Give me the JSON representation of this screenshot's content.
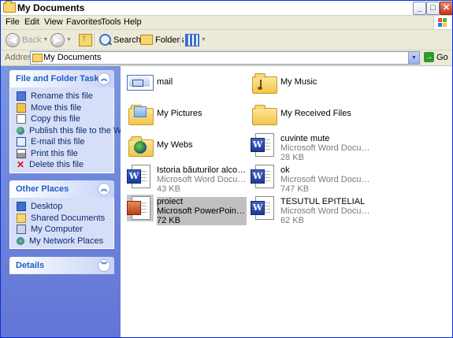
{
  "window": {
    "title": "My Documents",
    "controls": {
      "minimize": "_",
      "maximize": "□",
      "close": "✕"
    }
  },
  "menu": [
    "File",
    "Edit",
    "View",
    "Favorites",
    "Tools",
    "Help"
  ],
  "toolbar": {
    "back": "Back",
    "search": "Search",
    "folders": "Folders"
  },
  "address": {
    "label": "Address",
    "value": "My Documents",
    "go": "Go"
  },
  "tasks": {
    "file_folder": {
      "title": "File and Folder Tasks",
      "items": [
        {
          "label": "Rename this file",
          "icon": "rename-icon"
        },
        {
          "label": "Move this file",
          "icon": "move-icon"
        },
        {
          "label": "Copy this file",
          "icon": "copy-icon"
        },
        {
          "label": "Publish this file to the Web",
          "icon": "globe-icon"
        },
        {
          "label": "E-mail this file",
          "icon": "email-icon"
        },
        {
          "label": "Print this file",
          "icon": "printer-icon"
        },
        {
          "label": "Delete this file",
          "icon": "delete-icon"
        }
      ]
    },
    "other_places": {
      "title": "Other Places",
      "items": [
        {
          "label": "Desktop",
          "icon": "desktop-icon"
        },
        {
          "label": "Shared Documents",
          "icon": "folder-icon"
        },
        {
          "label": "My Computer",
          "icon": "computer-icon"
        },
        {
          "label": "My Network Places",
          "icon": "network-icon"
        }
      ]
    },
    "details": {
      "title": "Details"
    }
  },
  "files": [
    {
      "name": "mail",
      "kind": "mail"
    },
    {
      "name": "My Music",
      "kind": "folder-music"
    },
    {
      "name": "My Pictures",
      "kind": "folder-pictures"
    },
    {
      "name": "My Received Files",
      "kind": "folder"
    },
    {
      "name": "My Webs",
      "kind": "folder-web"
    },
    {
      "name": "cuvinte mute",
      "type": "Microsoft Word Document",
      "size": "28 KB",
      "kind": "word"
    },
    {
      "name": "Istoria băuturilor alcoolice",
      "type": "Microsoft Word Document",
      "size": "43 KB",
      "kind": "word"
    },
    {
      "name": "ok",
      "type": "Microsoft Word Document",
      "size": "747 KB",
      "kind": "word"
    },
    {
      "name": "proiect",
      "type": "Microsoft PowerPoint Present...",
      "size": "72 KB",
      "kind": "powerpoint",
      "selected": true
    },
    {
      "name": "TESUTUL EPITELIAL",
      "type": "Microsoft Word Document",
      "size": "62 KB",
      "kind": "word"
    }
  ],
  "colors": {
    "taskpane_gradient": [
      "#7a96df",
      "#6375d6"
    ],
    "panel_title": "#215dc6",
    "selection": "#c0c0c0"
  }
}
